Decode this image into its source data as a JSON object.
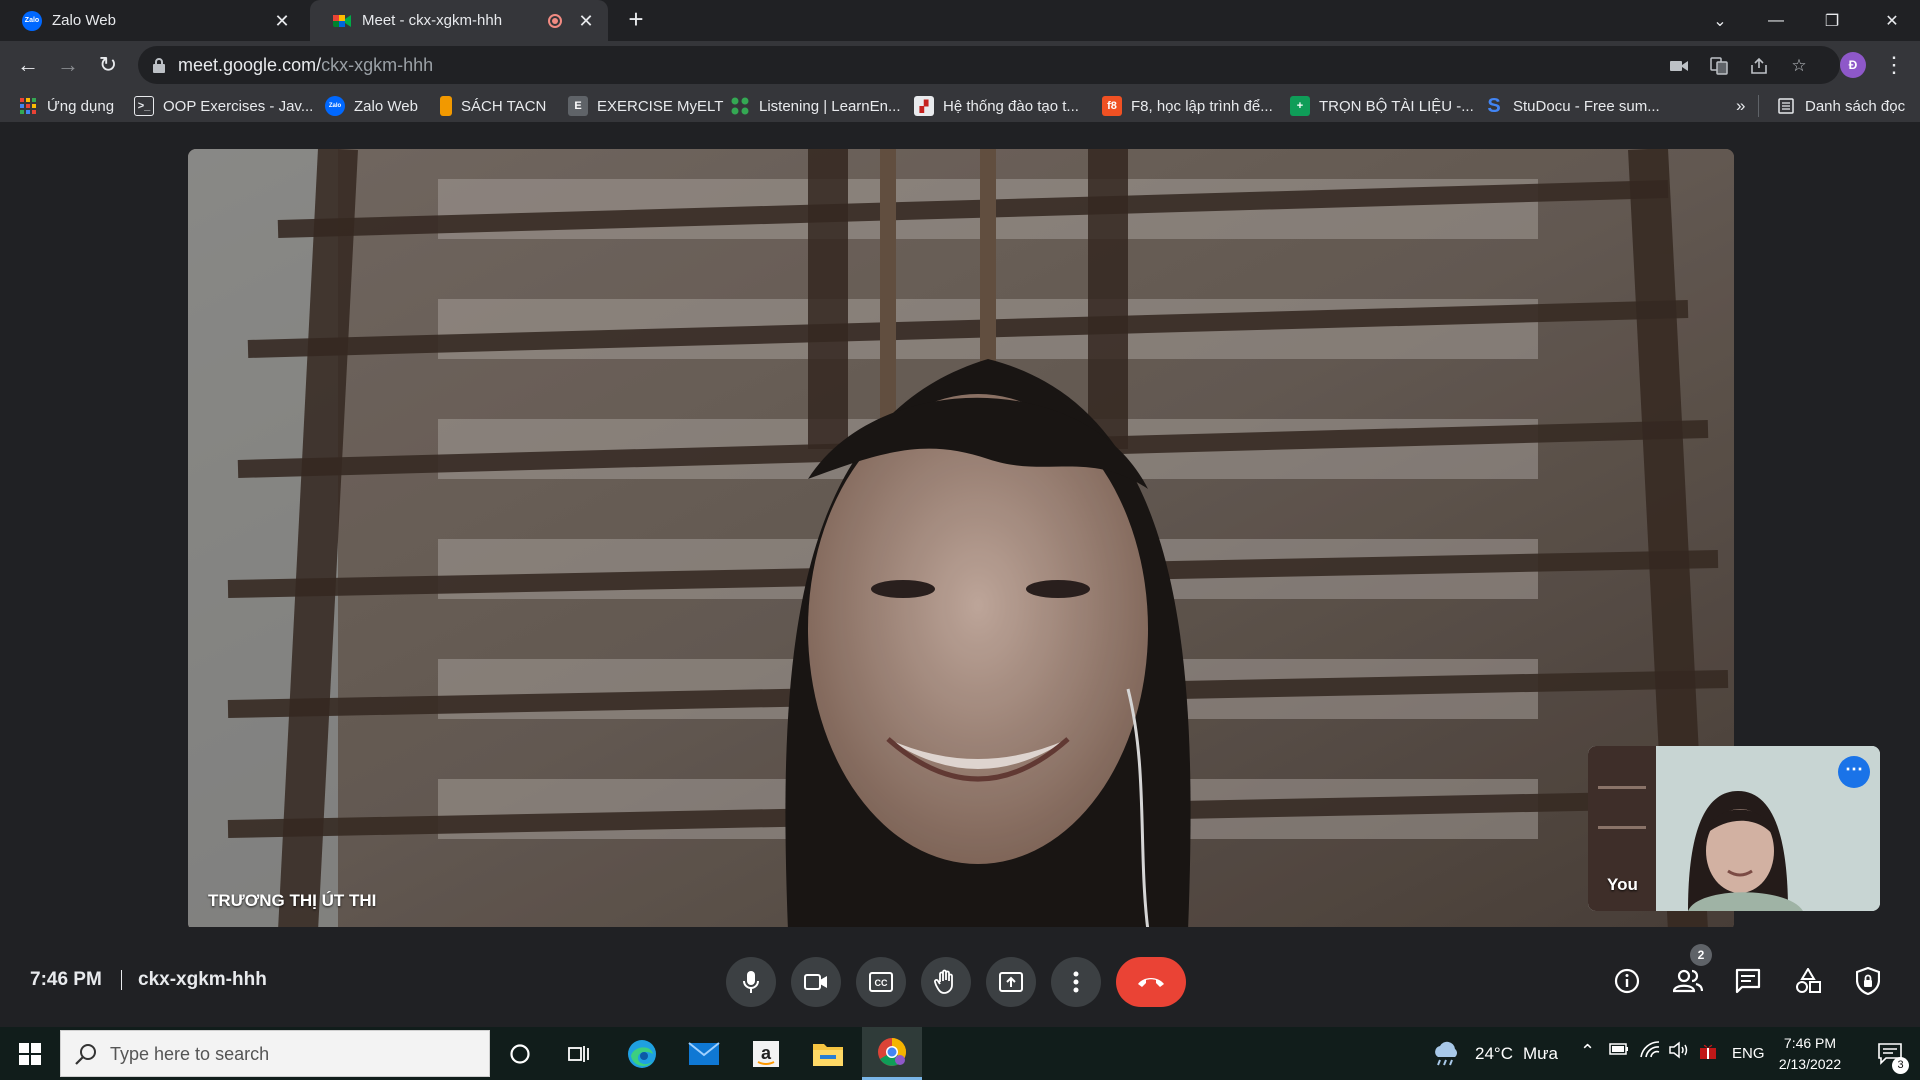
{
  "browser": {
    "tabs": [
      {
        "title": "Zalo Web",
        "favicon": "zalo-icon",
        "favicon_color": "#0068ff",
        "active": false
      },
      {
        "title": "Meet - ckx-xgkm-hhh",
        "favicon": "google-meet-icon",
        "active": true
      }
    ],
    "url_host": "meet.google.com/",
    "url_path": "ckx-xgkm-hhh",
    "profile_initial": "Đ",
    "profile_color": "#8e58c9"
  },
  "bookmarks": [
    {
      "label": "Ứng dụng",
      "icon": "apps-grid-icon"
    },
    {
      "label": "OOP Exercises - Jav...",
      "icon": "terminal-icon"
    },
    {
      "label": "Zalo Web",
      "icon": "zalo-icon"
    },
    {
      "label": "SÁCH TACN",
      "icon": "book-icon"
    },
    {
      "label": "EXERCISE MyELT",
      "icon": "e-letter-icon"
    },
    {
      "label": "Listening | LearnEn...",
      "icon": "learnenglish-icon"
    },
    {
      "label": "Hệ thống đào tạo t...",
      "icon": "school-icon"
    },
    {
      "label": "F8, học lập trình để...",
      "icon": "f8-icon"
    },
    {
      "label": "TRỌN BỘ TÀI LIỆU -...",
      "icon": "green-cross-icon"
    },
    {
      "label": "StuDocu - Free sum...",
      "icon": "studocu-icon"
    }
  ],
  "bookmarks_overflow": "»",
  "reading_list": "Danh sách đọc",
  "meet": {
    "main_participant": "TRƯƠNG THỊ ÚT THI",
    "self_label": "You",
    "time": "7:46 PM",
    "separator": "|",
    "meeting_code": "ckx-xgkm-hhh",
    "participant_count": "2",
    "end_call_color": "#ea4335",
    "controls": [
      "microphone-icon",
      "camera-icon",
      "captions-icon",
      "raise-hand-icon",
      "present-icon",
      "more-options-icon",
      "end-call-icon"
    ],
    "side_controls": [
      "info-icon",
      "people-icon",
      "chat-icon",
      "activities-icon",
      "host-controls-icon"
    ]
  },
  "taskbar": {
    "search_placeholder": "Type here to search",
    "weather": "24°C",
    "weather_desc": "Mưa",
    "language": "ENG",
    "time": "7:46 PM",
    "date": "2/13/2022",
    "notification_count": "3"
  }
}
